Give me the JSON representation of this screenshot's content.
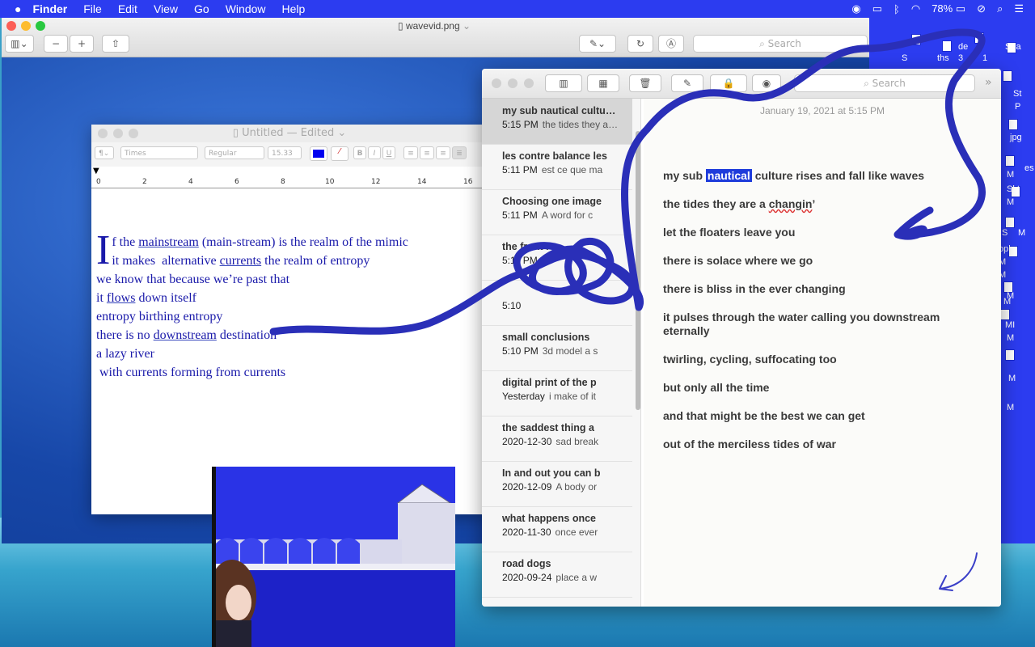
{
  "menubar": {
    "apple_icon": "apple-logo",
    "app_name": "Finder",
    "items": [
      "File",
      "Edit",
      "View",
      "Go",
      "Window",
      "Help"
    ],
    "battery": "78%"
  },
  "preview": {
    "title": "wavevid.png",
    "search_placeholder": "Search"
  },
  "textedit": {
    "title": "Untitled",
    "edited": "— Edited",
    "font_family": "Times",
    "font_style": "Regular",
    "font_size": "15.33",
    "ruler_numbers": [
      "0",
      "2",
      "4",
      "6",
      "8",
      "10",
      "12",
      "14",
      "16"
    ],
    "poem": {
      "drop_cap": "I",
      "line1_a": "f the ",
      "line1_u": "mainstream",
      "line1_b": " (main-stream) is the realm of the mimic",
      "line2_a": "it makes  alternative ",
      "line2_u": "currents",
      "line2_b": " the realm of entropy",
      "line3": "we know that because we’re past that",
      "line4_a": "it ",
      "line4_u": "flows",
      "line4_b": " down itself",
      "line5": "entropy birthing entropy",
      "line6_a": "there is no ",
      "line6_u": "downstream",
      "line6_b": " destination",
      "line7": "a lazy river",
      "line8": " with currents forming from currents"
    }
  },
  "notes": {
    "search_placeholder": "Search",
    "list": [
      {
        "title": "my sub nautical culture rises",
        "time": "5:15 PM",
        "preview": "the tides they are a changin"
      },
      {
        "title": "les contre balance les",
        "time": "5:11 PM",
        "preview": "est ce que ma"
      },
      {
        "title": "Choosing one image",
        "time": "5:11 PM",
        "preview": "A word for c"
      },
      {
        "title": "the front i",
        "time": "5:11 PM",
        "preview": ""
      },
      {
        "title": "",
        "time": "5:10",
        "preview": ""
      },
      {
        "title": "small conclusions",
        "time": "5:10 PM",
        "preview": "3d model a s"
      },
      {
        "title": "digital print of the p",
        "time": "Yesterday",
        "preview": "i make of it"
      },
      {
        "title": "the saddest thing a",
        "time": "2020-12-30",
        "preview": "sad break"
      },
      {
        "title": "In and out you can b",
        "time": "2020-12-09",
        "preview": "A body or"
      },
      {
        "title": "what happens once",
        "time": "2020-11-30",
        "preview": "once ever"
      },
      {
        "title": "road dogs",
        "time": "2020-09-24",
        "preview": "place a w"
      }
    ],
    "date": "January 19, 2021 at 5:15 PM",
    "body": {
      "l1_a": "my sub ",
      "l1_hl": "nautical",
      "l1_b": " culture rises and fall like waves",
      "l2_a": "the tides they are a ",
      "l2_sq": "changin",
      "l2_b": "’",
      "l3": "let the floaters leave you",
      "l4": "there is solace where we go",
      "l5": "there is bliss in the ever changing",
      "l6": "it pulses through the water calling you downstream eternally",
      "l7": "twirling, cycling, suffocating too",
      "l8": "but only all the time",
      "l9": "and that might be the best we can get",
      "l10": "out  of  the merciless tides of war"
    }
  },
  "desktop_labels": [
    "de",
    "Spa",
    "S",
    "ths",
    "3",
    "1",
    "St",
    "P",
    "jpg",
    "M",
    "es",
    "Skt",
    "M",
    "S",
    "M",
    "M",
    "ople",
    "M",
    "M",
    "MI",
    "M",
    "M",
    "M",
    "M"
  ],
  "colors": {
    "menubar": "#2c3cf0",
    "ink": "#1a1aaa",
    "highlight": "#1e3cdb",
    "scribble": "#2a2fb8"
  }
}
